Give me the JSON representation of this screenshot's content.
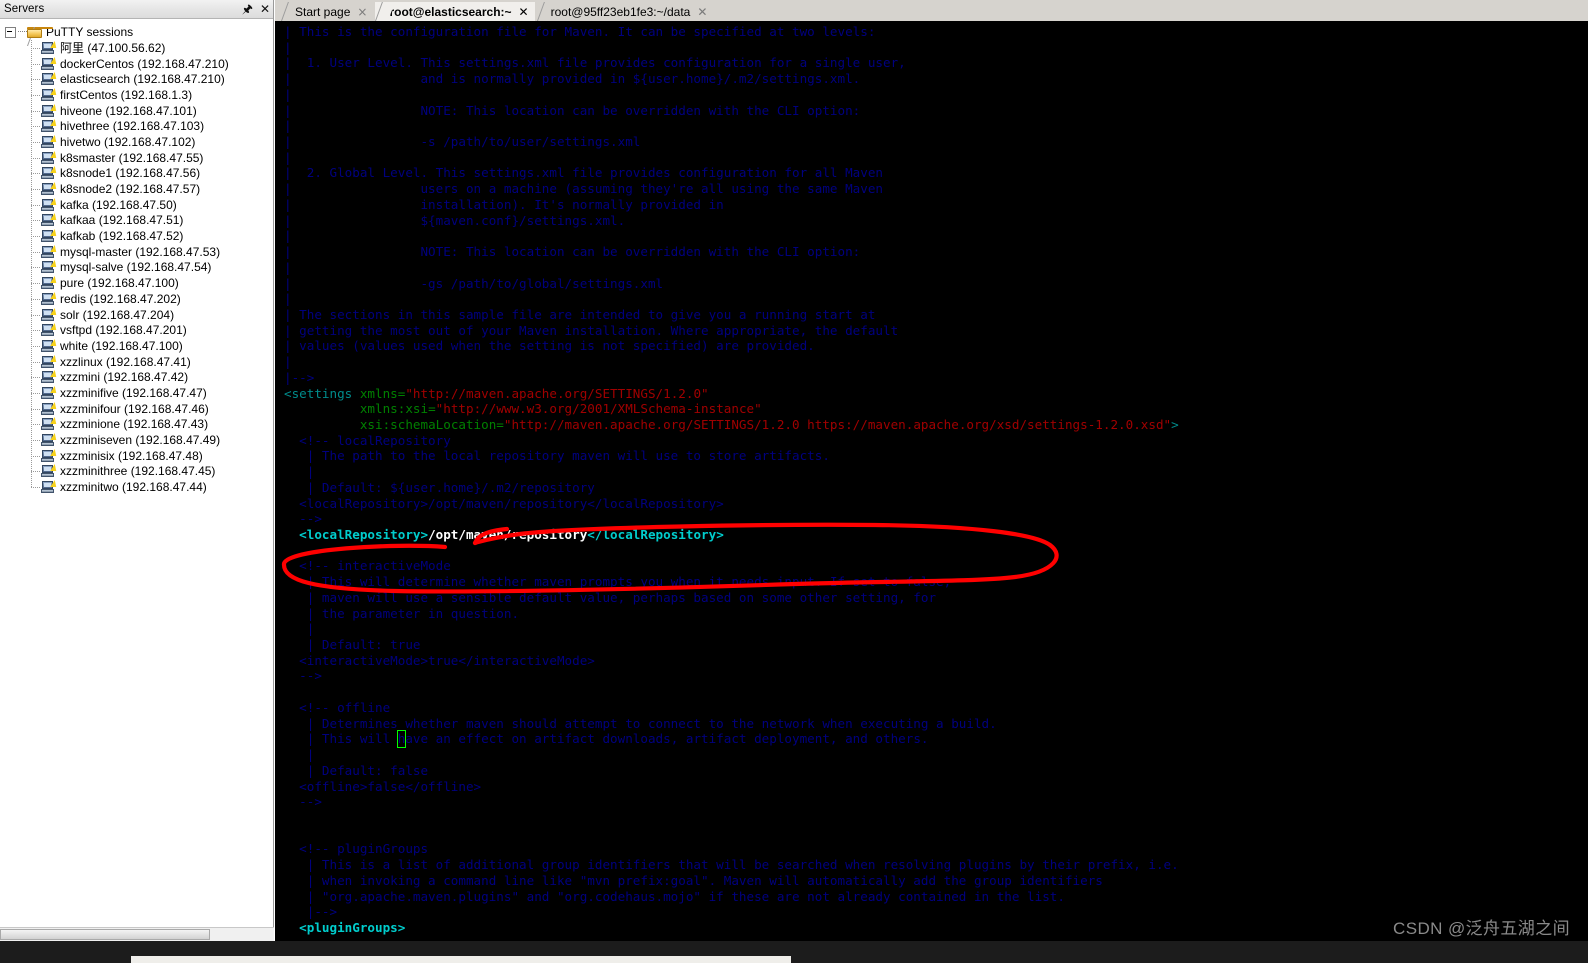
{
  "servers_panel": {
    "title": "Servers",
    "pin_icon": "pin-icon",
    "close_icon": "close-icon",
    "root_label": "PuTTY sessions",
    "items": [
      {
        "name": "阿里",
        "host": "(47.100.56.62)",
        "label": "阿里 (47.100.56.62)"
      },
      {
        "name": "dockerCentos",
        "host": "(192.168.47.210)",
        "label": "dockerCentos (192.168.47.210)"
      },
      {
        "name": "elasticsearch",
        "host": "(192.168.47.210)",
        "label": "elasticsearch (192.168.47.210)"
      },
      {
        "name": "firstCentos",
        "host": "(192.168.1.3)",
        "label": "firstCentos (192.168.1.3)"
      },
      {
        "name": "hiveone",
        "host": "(192.168.47.101)",
        "label": "hiveone (192.168.47.101)"
      },
      {
        "name": "hivethree",
        "host": "(192.168.47.103)",
        "label": "hivethree (192.168.47.103)"
      },
      {
        "name": "hivetwo",
        "host": "(192.168.47.102)",
        "label": "hivetwo (192.168.47.102)"
      },
      {
        "name": "k8smaster",
        "host": "(192.168.47.55)",
        "label": "k8smaster (192.168.47.55)"
      },
      {
        "name": "k8snode1",
        "host": "(192.168.47.56)",
        "label": "k8snode1 (192.168.47.56)"
      },
      {
        "name": "k8snode2",
        "host": "(192.168.47.57)",
        "label": "k8snode2 (192.168.47.57)"
      },
      {
        "name": "kafka",
        "host": "(192.168.47.50)",
        "label": "kafka (192.168.47.50)"
      },
      {
        "name": "kafkaa",
        "host": "(192.168.47.51)",
        "label": "kafkaa (192.168.47.51)"
      },
      {
        "name": "kafkab",
        "host": "(192.168.47.52)",
        "label": "kafkab (192.168.47.52)"
      },
      {
        "name": "mysql-master",
        "host": "(192.168.47.53)",
        "label": "mysql-master (192.168.47.53)"
      },
      {
        "name": "mysql-salve",
        "host": "(192.168.47.54)",
        "label": "mysql-salve (192.168.47.54)"
      },
      {
        "name": "pure",
        "host": "(192.168.47.100)",
        "label": "pure (192.168.47.100)"
      },
      {
        "name": "redis",
        "host": "(192.168.47.202)",
        "label": "redis (192.168.47.202)"
      },
      {
        "name": "solr",
        "host": "(192.168.47.204)",
        "label": "solr (192.168.47.204)"
      },
      {
        "name": "vsftpd",
        "host": "(192.168.47.201)",
        "label": "vsftpd (192.168.47.201)"
      },
      {
        "name": "white",
        "host": "(192.168.47.100)",
        "label": "white (192.168.47.100)"
      },
      {
        "name": "xzzlinux",
        "host": "(192.168.47.41)",
        "label": "xzzlinux (192.168.47.41)"
      },
      {
        "name": "xzzmini",
        "host": "(192.168.47.42)",
        "label": "xzzmini (192.168.47.42)"
      },
      {
        "name": "xzzminifive",
        "host": "(192.168.47.47)",
        "label": "xzzminifive (192.168.47.47)"
      },
      {
        "name": "xzzminifour",
        "host": "(192.168.47.46)",
        "label": "xzzminifour (192.168.47.46)"
      },
      {
        "name": "xzzminione",
        "host": "(192.168.47.43)",
        "label": "xzzminione (192.168.47.43)"
      },
      {
        "name": "xzzminiseven",
        "host": "(192.168.47.49)",
        "label": "xzzminiseven (192.168.47.49)"
      },
      {
        "name": "xzzminisix",
        "host": "(192.168.47.48)",
        "label": "xzzminisix (192.168.47.48)"
      },
      {
        "name": "xzzminithree",
        "host": "(192.168.47.45)",
        "label": "xzzminithree (192.168.47.45)"
      },
      {
        "name": "xzzminitwo",
        "host": "(192.168.47.44)",
        "label": "xzzminitwo (192.168.47.44)"
      }
    ]
  },
  "tabs": [
    {
      "label": "Start page",
      "active": false,
      "close": "×"
    },
    {
      "label": "root@elasticsearch:~",
      "active": true,
      "close": "✕"
    },
    {
      "label": "root@95ff23eb1fe3:~/data",
      "active": false,
      "close": "✕"
    }
  ],
  "terminal": {
    "colors": {
      "background": "#000000",
      "comment": "#00007f",
      "tag": "#008b8b",
      "attribute": "#008000",
      "string": "#a00000",
      "plain_text": "#cccccc",
      "bright_tag": "#00cdcd",
      "bright_text": "#ffffff",
      "cursor_outline": "#00ff00",
      "annotation": "#ff0000"
    },
    "cursor": {
      "char": "h",
      "line": 47,
      "column": 14
    },
    "lines": [
      [
        {
          "t": "| This is the configuration file for Maven. It can be specified at two levels:",
          "c": "comment"
        }
      ],
      [
        {
          "t": "|",
          "c": "comment"
        }
      ],
      [
        {
          "t": "|  1. User Level. This settings.xml file provides configuration for a single user,",
          "c": "comment"
        }
      ],
      [
        {
          "t": "|                 and is normally provided in ${user.home}/.m2/settings.xml.",
          "c": "comment"
        }
      ],
      [
        {
          "t": "|",
          "c": "comment"
        }
      ],
      [
        {
          "t": "|                 NOTE: This location can be overridden with the CLI option:",
          "c": "comment"
        }
      ],
      [
        {
          "t": "|",
          "c": "comment"
        }
      ],
      [
        {
          "t": "|                 -s /path/to/user/settings.xml",
          "c": "comment"
        }
      ],
      [
        {
          "t": "|",
          "c": "comment"
        }
      ],
      [
        {
          "t": "|  2. Global Level. This settings.xml file provides configuration for all Maven",
          "c": "comment"
        }
      ],
      [
        {
          "t": "|                 users on a machine (assuming they're all using the same Maven",
          "c": "comment"
        }
      ],
      [
        {
          "t": "|                 installation). It's normally provided in",
          "c": "comment"
        }
      ],
      [
        {
          "t": "|                 ${maven.conf}/settings.xml.",
          "c": "comment"
        }
      ],
      [
        {
          "t": "|",
          "c": "comment"
        }
      ],
      [
        {
          "t": "|                 NOTE: This location can be overridden with the CLI option:",
          "c": "comment"
        }
      ],
      [
        {
          "t": "|",
          "c": "comment"
        }
      ],
      [
        {
          "t": "|                 -gs /path/to/global/settings.xml",
          "c": "comment"
        }
      ],
      [
        {
          "t": "|",
          "c": "comment"
        }
      ],
      [
        {
          "t": "| The sections in this sample file are intended to give you a running start at",
          "c": "comment"
        }
      ],
      [
        {
          "t": "| getting the most out of your Maven installation. Where appropriate, the default",
          "c": "comment"
        }
      ],
      [
        {
          "t": "| values (values used when the setting is not specified) are provided.",
          "c": "comment"
        }
      ],
      [
        {
          "t": "|",
          "c": "comment"
        }
      ],
      [
        {
          "t": "|-->",
          "c": "comment"
        }
      ],
      [
        {
          "t": "<settings ",
          "c": "tag"
        },
        {
          "t": "xmlns=",
          "c": "attr"
        },
        {
          "t": "\"http://maven.apache.org/SETTINGS/1.2.0\"",
          "c": "str"
        }
      ],
      [
        {
          "t": "          ",
          "c": "plain"
        },
        {
          "t": "xmlns:xsi=",
          "c": "attr"
        },
        {
          "t": "\"http://www.w3.org/2001/XMLSchema-instance\"",
          "c": "str"
        }
      ],
      [
        {
          "t": "          ",
          "c": "plain"
        },
        {
          "t": "xsi:schemaLocation=",
          "c": "attr"
        },
        {
          "t": "\"http://maven.apache.org/SETTINGS/1.2.0 https://maven.apache.org/xsd/settings-1.2.0.xsd\"",
          "c": "str"
        },
        {
          "t": ">",
          "c": "tag"
        }
      ],
      [
        {
          "t": "  <!-- localRepository",
          "c": "comment"
        }
      ],
      [
        {
          "t": "   | The path to the local repository maven will use to store artifacts.",
          "c": "comment"
        }
      ],
      [
        {
          "t": "   |",
          "c": "comment"
        }
      ],
      [
        {
          "t": "   | Default: ${user.home}/.m2/repository",
          "c": "comment"
        }
      ],
      [
        {
          "t": "  <localRepository>/opt/maven/repository</localRepository>",
          "c": "comment"
        }
      ],
      [
        {
          "t": "  -->",
          "c": "comment"
        }
      ],
      [
        {
          "t": "  <localRepository>",
          "c": "bright_tag"
        },
        {
          "t": "/opt/maven/repository",
          "c": "bright_txt"
        },
        {
          "t": "</localRepository>",
          "c": "bright_tag"
        }
      ],
      [
        {
          "t": "",
          "c": "plain"
        }
      ],
      [
        {
          "t": "  <!-- interactiveMode",
          "c": "comment"
        }
      ],
      [
        {
          "t": "   | This will determine whether maven prompts you when it needs input. If set to false,",
          "c": "comment"
        }
      ],
      [
        {
          "t": "   | maven will use a sensible default value, perhaps based on some other setting, for",
          "c": "comment"
        }
      ],
      [
        {
          "t": "   | the parameter in question.",
          "c": "comment"
        }
      ],
      [
        {
          "t": "   |",
          "c": "comment"
        }
      ],
      [
        {
          "t": "   | Default: true",
          "c": "comment"
        }
      ],
      [
        {
          "t": "  <interactiveMode>true</interactiveMode>",
          "c": "comment"
        }
      ],
      [
        {
          "t": "  -->",
          "c": "comment"
        }
      ],
      [
        {
          "t": "",
          "c": "plain"
        }
      ],
      [
        {
          "t": "  <!-- offline",
          "c": "comment"
        }
      ],
      [
        {
          "t": "   | Determines whether maven should attempt to connect to the network when executing a build.",
          "c": "comment"
        }
      ],
      [
        {
          "t": "   | This will ",
          "c": "comment"
        },
        {
          "t": "h",
          "c": "cursor"
        },
        {
          "t": "ave an effect on artifact downloads, artifact deployment, and others.",
          "c": "comment"
        }
      ],
      [
        {
          "t": "   |",
          "c": "comment"
        }
      ],
      [
        {
          "t": "   | Default: false",
          "c": "comment"
        }
      ],
      [
        {
          "t": "  <offline>false</offline>",
          "c": "comment"
        }
      ],
      [
        {
          "t": "  -->",
          "c": "comment"
        }
      ],
      [
        {
          "t": "",
          "c": "plain"
        }
      ],
      [
        {
          "t": "",
          "c": "plain"
        }
      ],
      [
        {
          "t": "  <!-- pluginGroups",
          "c": "comment"
        }
      ],
      [
        {
          "t": "   | This is a list of additional group identifiers that will be searched when resolving plugins by their prefix, i.e.",
          "c": "comment"
        }
      ],
      [
        {
          "t": "   | when invoking a command line like \"mvn prefix:goal\". Maven will automatically add the group identifiers",
          "c": "comment"
        }
      ],
      [
        {
          "t": "   | \"org.apache.maven.plugins\" and \"org.codehaus.mojo\" if these are not already contained in the list.",
          "c": "comment"
        }
      ],
      [
        {
          "t": "   |-->",
          "c": "comment"
        }
      ],
      [
        {
          "t": "  <pluginGroups>",
          "c": "bright_tag"
        }
      ]
    ]
  },
  "watermark": {
    "text": "CSDN @泛舟五湖之间"
  }
}
